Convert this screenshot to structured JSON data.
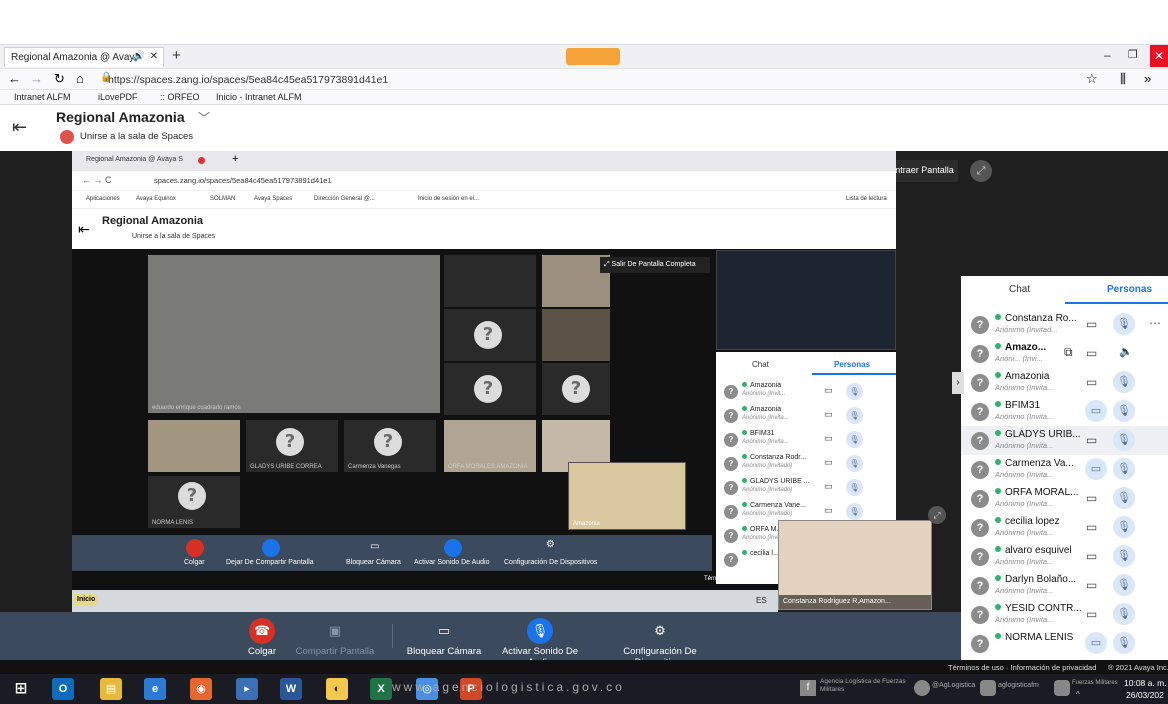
{
  "firefox": {
    "tab_title": "Regional Amazonia @ Avay",
    "url": "https://spaces.zang.io/spaces/5ea84c45ea517973891d41e1",
    "bookmarks": [
      "Intranet ALFM",
      "iLovePDF",
      ":: ORFEO",
      "Inicio - Intranet ALFM"
    ]
  },
  "space": {
    "title": "Regional Amazonia",
    "join_label": "Unirse a la sala de Spaces"
  },
  "overlay": {
    "collapse_label": "Contraer Pantalla"
  },
  "inner": {
    "tab_title": "Regional Amazonia @ Avaya S",
    "url": "spaces.zang.io/spaces/5ea84c45ea517973891d41e1",
    "bookmarks": [
      "Aplicaciones",
      "Avaya Equinox",
      "SOLMAN",
      "Avaya Spaces",
      "Dirección General @...",
      "Inicio de sesión en el..."
    ],
    "reading_list": "Lista de lectura",
    "exit_fullscreen": "Salir De Pantalla Completa",
    "tile_labels": [
      "eduardo enrique cuadrado ramos",
      "GLADYS URIBE CORREA",
      "Carmenza Vanegas",
      "ORFA MORALES AMAZONIA",
      "NORMA LENIS",
      "Amazonia"
    ],
    "controls": [
      "Colgar",
      "Dejar De Compartir Pantalla",
      "Bloquear Cámara",
      "Activar Sonido De Audio",
      "Configuración De Dispositivos"
    ],
    "panel_tabs": [
      "Chat",
      "Personas"
    ],
    "people": [
      {
        "name": "Amazonia",
        "sub": "Anónimo (Invit..."
      },
      {
        "name": "Amazonia",
        "sub": "Anónimo (Invita..."
      },
      {
        "name": "BFIM31",
        "sub": "Anónimo (Invita..."
      },
      {
        "name": "Constanza Rodr...",
        "sub": "Anónimo (Invitado)"
      },
      {
        "name": "GLADYS URIBE ...",
        "sub": "Anónimo (Invitado)"
      },
      {
        "name": "Carmenza Vane...",
        "sub": "Anónimo (Invitado)"
      },
      {
        "name": "ORFA M...",
        "sub": "Anónimo (Invita..."
      },
      {
        "name": "cecilia l...",
        "sub": ""
      }
    ],
    "terms": "Términos de uso · Informaci",
    "taskbar_start": "Inicio",
    "lang": "ES"
  },
  "controls": [
    {
      "label": "Colgar"
    },
    {
      "label": "Compartir Pantalla"
    },
    {
      "label": "Bloquear Cámara"
    },
    {
      "label": "Activar Sonido De Audio"
    },
    {
      "label": "Configuración De Dispositivos"
    }
  ],
  "panel": {
    "tabs": [
      "Chat",
      "Personas"
    ],
    "active_tab": "Personas",
    "people": [
      {
        "name": "Constanza Ro...",
        "sub": "Anónimo (Invitad..."
      },
      {
        "name": "Amazo...",
        "sub": "Anóni... (Invi..."
      },
      {
        "name": "Amazonia",
        "sub": "Anónimo (Invita..."
      },
      {
        "name": "BFIM31",
        "sub": "Anónimo (Invita..."
      },
      {
        "name": "GLADYS URIB...",
        "sub": "Anónimo (Invita..."
      },
      {
        "name": "Carmenza Va...",
        "sub": "Anónimo (Invita..."
      },
      {
        "name": "ORFA MORAL...",
        "sub": "Anónimo (Invita..."
      },
      {
        "name": "cecilia lopez",
        "sub": "Anónimo (Invita..."
      },
      {
        "name": "alvaro esquivel",
        "sub": "Anónimo (Invita..."
      },
      {
        "name": "Darlyn Bolaño...",
        "sub": "Anónimo (Invita..."
      },
      {
        "name": "YESID CONTR...",
        "sub": "Anónimo (Invita..."
      },
      {
        "name": "NORMA LENIS",
        "sub": ""
      }
    ]
  },
  "self_view_label": "Constanza Rodriguez R,Amazon...",
  "footer": {
    "terms": "Términos de uso · Información de privacidad",
    "copyright": "® 2021 Avaya Inc."
  },
  "taskbar": {
    "website": "www.agenciologistica.gov.co",
    "social": [
      "Agencia Logística de Fuerzas Militares",
      "@AgLogistica",
      "aglogisticafm",
      "Fuerzas Militares"
    ],
    "time": "10:08 a. m.",
    "date": "26/03/202"
  },
  "colors": {
    "accent": "#1a73e8",
    "control_bar": "#3b4a5c",
    "hangup": "#d93025"
  }
}
